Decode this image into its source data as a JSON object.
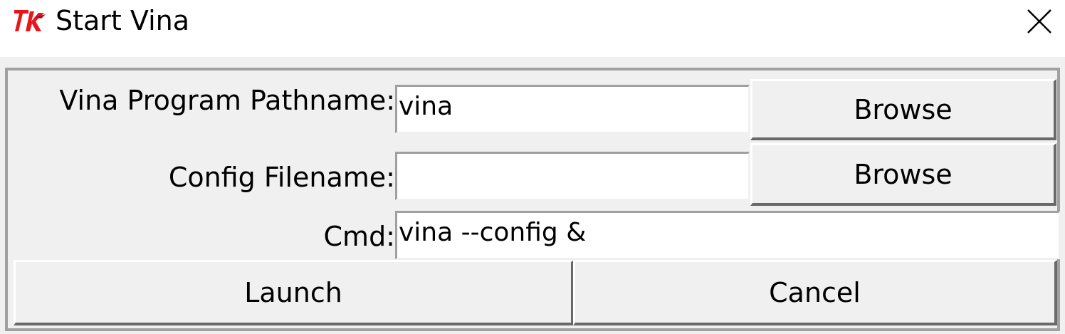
{
  "window": {
    "title": "Start Vina",
    "icon": "tk-feather-icon",
    "close_icon": "close-icon"
  },
  "form": {
    "vina_label": "Vina Program Pathname:",
    "vina_value": "vina",
    "vina_browse": "Browse",
    "config_label": "Config Filename:",
    "config_value": "",
    "config_browse": "Browse",
    "cmd_label": "Cmd:",
    "cmd_value": "vina --config &"
  },
  "actions": {
    "launch": "Launch",
    "cancel": "Cancel"
  },
  "colors": {
    "background": "#f0f0f0",
    "entry_bg": "#ffffff",
    "logo_red": "#e8151b"
  }
}
